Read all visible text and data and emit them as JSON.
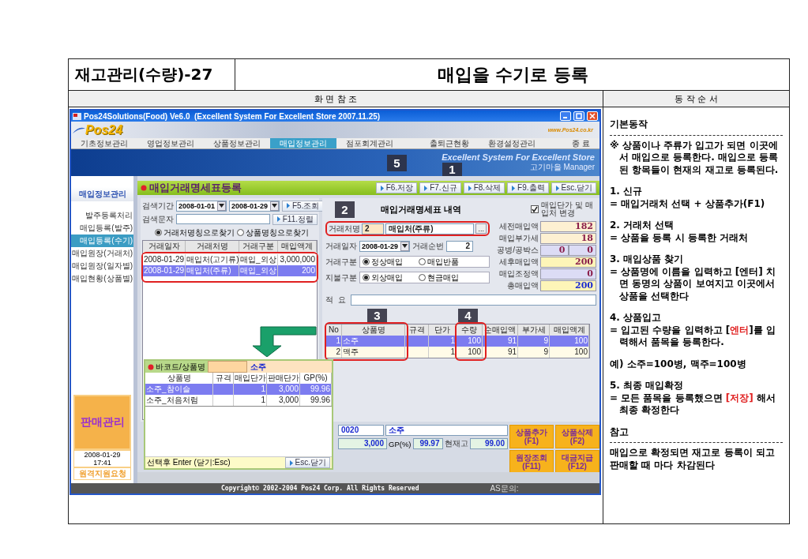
{
  "header": {
    "code": "재고관리(수량)-27",
    "title": "매입을 수기로 등록"
  },
  "section_titles": [
    "화 면 참 조",
    "동 작 순 서"
  ],
  "app": {
    "title": "Pos24Solutions(Food) Ve6.0  (Excellent System For Excellent Store 2007.11.25)",
    "logo": "Pos24",
    "site": "www.Pos24.co.kr",
    "menu": [
      {
        "label": "기초정보관리",
        "selected": false
      },
      {
        "label": "영업정보관리",
        "selected": false
      },
      {
        "label": "상품정보관리",
        "selected": false
      },
      {
        "label": "매입정보관리",
        "selected": true
      },
      {
        "label": "점포회계관리",
        "selected": false
      }
    ],
    "menu_right": [
      "출퇴근현황",
      "환경설정관리",
      "종 료"
    ],
    "banner": {
      "slogan": "Excellent System For Excellent Store",
      "user": "고기마을 Manager"
    },
    "sidebar": {
      "title": "매입정보관리",
      "items": [
        {
          "label": "발주등록처리",
          "selected": false
        },
        {
          "label": "매입등록(발주)",
          "selected": false
        },
        {
          "label": "매입등록(수기)",
          "selected": true
        },
        {
          "label": "매입원장(거래처)",
          "selected": false
        },
        {
          "label": "매입원장(일자별)",
          "selected": false
        },
        {
          "label": "매입현황(상품별)",
          "selected": false
        }
      ],
      "sales": "판매관리",
      "datetime": "2008-01-29 17:41",
      "remote": "원격지원요청"
    },
    "form_title": "매입거래명세표등록",
    "actions": [
      "F6.저장",
      "F7.신규",
      "F8.삭제",
      "F9.출력",
      "Esc.닫기"
    ],
    "search": {
      "period_label": "검색기간",
      "from": "2008-01-01",
      "to": "2008-01-29",
      "query_button": "F5.조회",
      "text_label": "검색문자",
      "sort_button": "F11.정렬",
      "radios": [
        {
          "label": "거래처명칭으로찾기",
          "selected": true
        },
        {
          "label": "상품명칭으로찾기",
          "selected": false
        }
      ]
    },
    "list": {
      "columns": [
        "거래일자",
        "거래처명",
        "거래구분",
        "매입액계"
      ],
      "rows": [
        {
          "cells": [
            "2008-01-29",
            "매입처(고기류)",
            "매입_외상",
            "3,000,000"
          ],
          "selected": false
        },
        {
          "cells": [
            "2008-01-29",
            "매입처(주류)",
            "매입_외상",
            "200"
          ],
          "selected": true
        }
      ]
    },
    "detail": {
      "title": "매입거래명세표 내역",
      "change_check": {
        "label": "매입단가 및 매입처 변경",
        "checked": true
      },
      "vendor_label": "거래처명",
      "vendor_code": "2",
      "vendor_name": "매입처(주류)",
      "browse": "...",
      "date_label": "거래일자",
      "date": "2008-01-29",
      "seq_label": "거래순번",
      "seq": "2",
      "type_label": "거래구분",
      "type_radios": [
        {
          "label": "정상매입",
          "selected": true
        },
        {
          "label": "매입반품",
          "selected": false
        }
      ],
      "pay_label": "지불구분",
      "pay_radios": [
        {
          "label": "외상매입",
          "selected": true
        },
        {
          "label": "현금매입",
          "selected": false
        }
      ],
      "memo_label": "적  요",
      "totals": [
        {
          "kind": "amount",
          "label": "세전매입액",
          "values": [
            "182"
          ],
          "color": "#fdf0d2"
        },
        {
          "kind": "amount",
          "label": "매입부가세",
          "values": [
            "18"
          ],
          "color": "#fdf0d2"
        },
        {
          "kind": "amount",
          "label": "공병/공박스",
          "values": [
            "0",
            "0"
          ],
          "color": "#dcdcf5"
        },
        {
          "kind": "amount",
          "label": "세후매입액",
          "values": [
            "200"
          ],
          "color": "#fdf5b8"
        },
        {
          "kind": "amount",
          "label": "매입조정액",
          "values": [
            "0"
          ],
          "color": "#dcdcf5"
        },
        {
          "kind": "total",
          "label": "총매입액",
          "values": [
            "200"
          ],
          "color": "#fdf5b8"
        }
      ],
      "columns": [
        "No",
        "상품명",
        "규격",
        "단가",
        "수량",
        "순매입액",
        "부가세",
        "매입액계"
      ],
      "rows": [
        {
          "cells": [
            "1",
            "소주",
            "",
            "1",
            "100",
            "91",
            "9",
            "100"
          ],
          "selected": true
        },
        {
          "cells": [
            "2",
            "맥주",
            "",
            "1",
            "100",
            "91",
            "9",
            "100"
          ],
          "selected": false
        }
      ]
    },
    "bottom": {
      "code": "0020",
      "name": "소주",
      "price": "3,000",
      "gp_label": "GP(%)",
      "gp": "99.97",
      "stock_label": "현재고",
      "stock": "99.00",
      "buttons": [
        "상품추가 (F1)",
        "상품삭제 (F2)",
        "원장조회 (F11)",
        "대금지급 (F12)"
      ]
    },
    "popup": {
      "label": "바코드/상품명",
      "query": "소주",
      "columns": [
        "상품명",
        "규격",
        "매입단가",
        "판매단가",
        "GP(%)"
      ],
      "rows": [
        {
          "cells": [
            "소주_참이슬",
            "",
            "1",
            "3,000",
            "99.96"
          ],
          "selected": true
        },
        {
          "cells": [
            "소주_처음처럼",
            "",
            "1",
            "3,000",
            "99.96"
          ],
          "selected": false
        }
      ],
      "hint": "선택후 Enter (닫기:Esc)",
      "close": "Esc.닫기"
    },
    "status": {
      "copyright": "Copyright© 2002-2004 Pos24 Corp. All Rights Reserved",
      "contact": "AS문의:"
    },
    "markers": [
      "5",
      "1",
      "2",
      "3",
      "4"
    ]
  },
  "instructions": [
    {
      "kind": "heading",
      "parts": [
        {
          "text": "기본동작",
          "highlight": false
        }
      ]
    },
    {
      "kind": "divider"
    },
    {
      "kind": "note",
      "parts": [
        {
          "text": "※ 상품이나 주류가 입고가 되면 이곳에서 매입으로 등록한다. 매입으로 등록된 항목들이 현재의 재고로 등록된다.",
          "highlight": false
        }
      ]
    },
    {
      "kind": "step",
      "parts": [
        {
          "text": "1. 신규",
          "highlight": false
        }
      ]
    },
    {
      "kind": "detail",
      "parts": [
        {
          "text": "= 매입거래처 선택 + 상품추가(F1)",
          "highlight": false
        }
      ]
    },
    {
      "kind": "step",
      "parts": [
        {
          "text": "2. 거래처 선택",
          "highlight": false
        }
      ]
    },
    {
      "kind": "detail",
      "parts": [
        {
          "text": "= 상품을 등록 시 등록한 거래처",
          "highlight": false
        }
      ]
    },
    {
      "kind": "step",
      "parts": [
        {
          "text": "3. 매입상품 찾기",
          "highlight": false
        }
      ]
    },
    {
      "kind": "detail",
      "parts": [
        {
          "text": "= 상품명에 이름을 입력하고 [엔터] 치면 동명의 상품이 보여지고 이곳에서 상품을 선택한다",
          "highlight": false
        }
      ]
    },
    {
      "kind": "step",
      "parts": [
        {
          "text": "4. 상품입고",
          "highlight": false
        }
      ]
    },
    {
      "kind": "detail",
      "parts": [
        {
          "text": "= 입고된 수량을 입력하고 [",
          "highlight": false
        },
        {
          "text": "엔터",
          "highlight": true
        },
        {
          "text": "]를 입력해서 품목을 등록한다.",
          "highlight": false
        }
      ]
    },
    {
      "kind": "example",
      "parts": [
        {
          "text": "예) 소주=100병, 맥주=100병",
          "highlight": false
        }
      ]
    },
    {
      "kind": "step",
      "parts": [
        {
          "text": "5. 최종 매입확정",
          "highlight": false
        }
      ]
    },
    {
      "kind": "detail",
      "parts": [
        {
          "text": "= 모든 품목을 등록했으면 ",
          "highlight": false
        },
        {
          "text": "[저장]",
          "highlight": true
        },
        {
          "text": " 해서 최종 확정한다",
          "highlight": false
        }
      ]
    },
    {
      "kind": "heading",
      "parts": [
        {
          "text": "참고",
          "highlight": false
        }
      ]
    },
    {
      "kind": "divider"
    },
    {
      "kind": "plain",
      "parts": [
        {
          "text": "매입으로 확정되면 재고로 등록이 되고 판매할 때 마다 차감된다",
          "highlight": false
        }
      ]
    }
  ]
}
